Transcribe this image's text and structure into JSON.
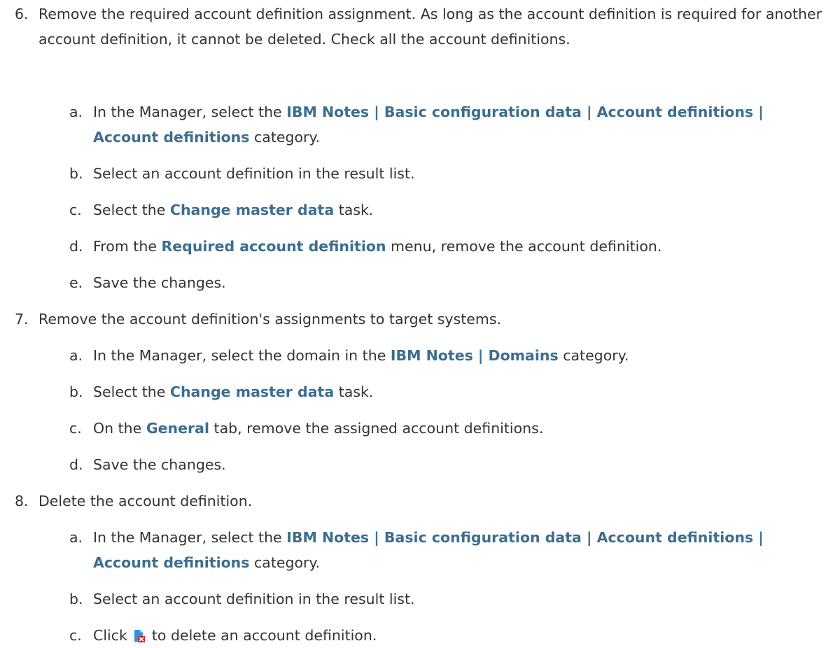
{
  "steps": [
    {
      "num": "6.",
      "text": "Remove the required account definition assignment. As long as the account definition is required for another account definition, it cannot be deleted. Check all the account definitions.",
      "subs": [
        {
          "letter": "a.",
          "pre": "In the Manager, select the ",
          "bold": "IBM Notes | Basic configuration data | Account definitions | Account definitions",
          "post": " category."
        },
        {
          "letter": "b.",
          "pre": "Select an account definition in the result list.",
          "bold": "",
          "post": ""
        },
        {
          "letter": "c.",
          "pre": "Select the ",
          "bold": "Change master data",
          "post": " task."
        },
        {
          "letter": "d.",
          "pre": "From the ",
          "bold": "Required account definition",
          "post": " menu, remove the account definition."
        },
        {
          "letter": "e.",
          "pre": "Save the changes.",
          "bold": "",
          "post": ""
        }
      ]
    },
    {
      "num": "7.",
      "text": "Remove the account definition's assignments to target systems.",
      "subs": [
        {
          "letter": "a.",
          "pre": "In the Manager, select the domain in the ",
          "bold": "IBM Notes | Domains",
          "post": " category."
        },
        {
          "letter": "b.",
          "pre": "Select the ",
          "bold": "Change master data",
          "post": " task."
        },
        {
          "letter": "c.",
          "pre": "On the ",
          "bold": "General",
          "post": " tab, remove the assigned account definitions."
        },
        {
          "letter": "d.",
          "pre": "Save the changes.",
          "bold": "",
          "post": ""
        }
      ]
    },
    {
      "num": "8.",
      "text": "Delete the account definition.",
      "subs": [
        {
          "letter": "a.",
          "pre": "In the Manager, select the ",
          "bold": "IBM Notes | Basic configuration data | Account definitions | Account definitions",
          "post": " category."
        },
        {
          "letter": "b.",
          "pre": "Select an account definition in the result list.",
          "bold": "",
          "post": ""
        },
        {
          "letter": "c.",
          "pre": "Click ",
          "bold": "",
          "post": " to delete an account definition.",
          "icon": "delete-account-definition-icon"
        }
      ]
    }
  ],
  "colors": {
    "text": "#333333",
    "bold": "#3c6e8f",
    "icon_blue": "#1e9be0",
    "icon_red": "#d9262c"
  }
}
